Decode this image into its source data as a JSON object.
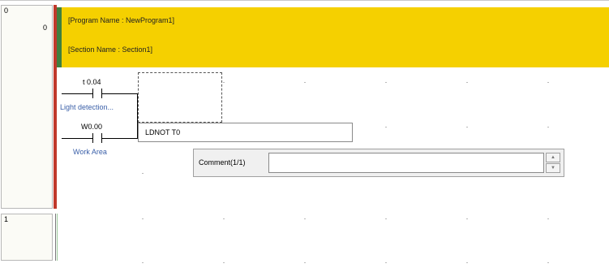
{
  "ladder": {
    "rungs": [
      {
        "rung_number": "0",
        "step_number": "0"
      },
      {
        "rung_number": "1"
      }
    ],
    "header": {
      "program_name": "[Program Name : NewProgram1]",
      "section_name": "[Section Name : Section1]"
    },
    "contacts": [
      {
        "address": "t 0.04",
        "comment": "Light detection..."
      },
      {
        "address": "W0.00",
        "comment": "Work Area"
      }
    ],
    "mnemonic_input": {
      "value": "LDNOT T0"
    },
    "comment_popup": {
      "label": "Comment(1/1)",
      "value": "",
      "spin_up": "▲",
      "spin_down": "▼"
    }
  },
  "colors": {
    "bus_red": "#c0392b",
    "bus_green": "#3f7f3f",
    "header_yellow": "#f5d000",
    "comment_text": "#3a5fa8"
  }
}
